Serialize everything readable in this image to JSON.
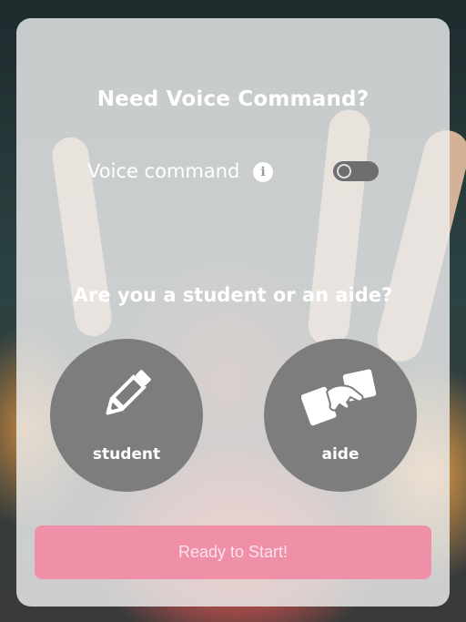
{
  "header": {
    "title": "Need Voice Command?"
  },
  "voice": {
    "label": "Voice command",
    "info_icon": "info-icon",
    "toggle_on": false
  },
  "roles": {
    "question": "Are you a student or an aide?",
    "items": [
      {
        "label": "student",
        "icon": "pencil-icon"
      },
      {
        "label": "aide",
        "icon": "handshake-icon"
      }
    ]
  },
  "footer": {
    "start_label": "Ready to Start!"
  },
  "colors": {
    "accent": "#f08fa8",
    "role_circle": "#7d7d7d",
    "toggle_off": "#6e6e6e"
  }
}
